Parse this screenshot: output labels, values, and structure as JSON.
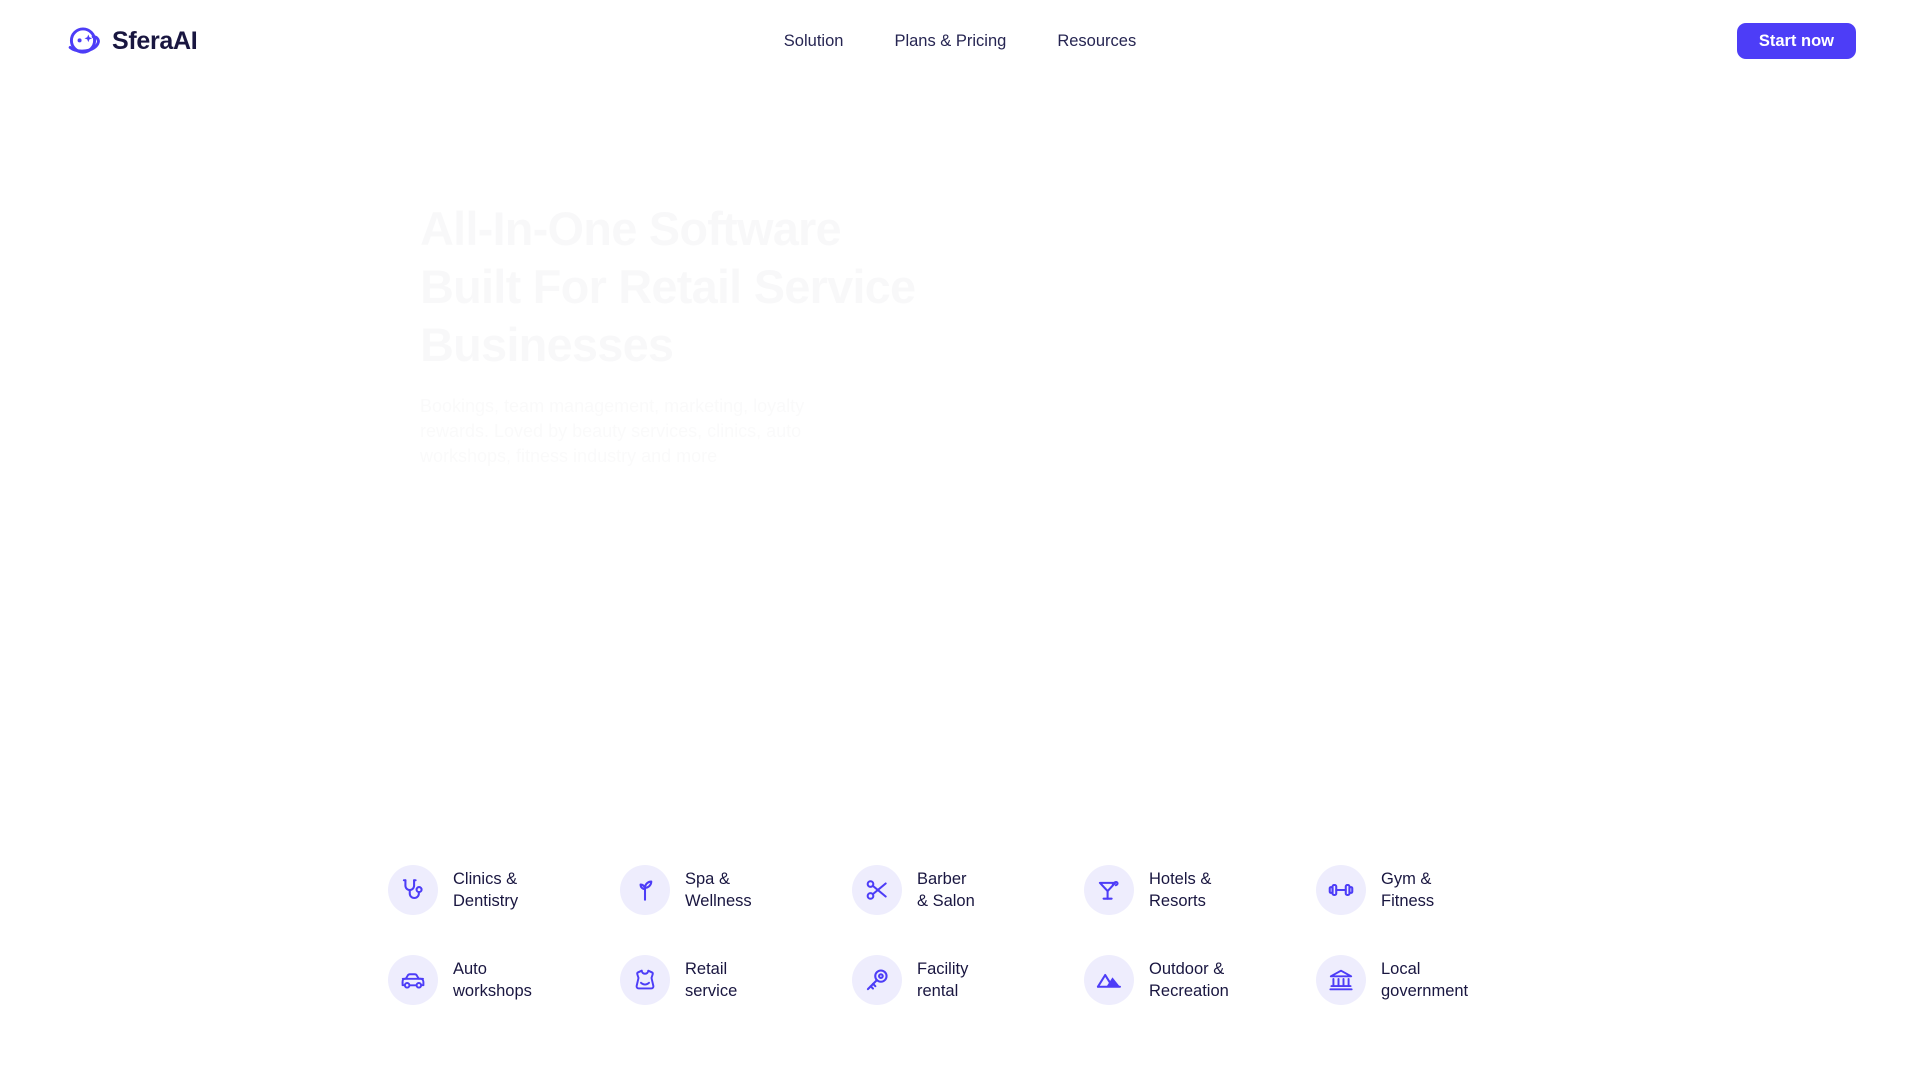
{
  "brand": {
    "name": "SferaAI",
    "logo_icon": "planet-sparkle-logo-icon",
    "accent_color": "#4D3DF7",
    "text_color": "#191640"
  },
  "nav": {
    "items": [
      {
        "label": "Solution"
      },
      {
        "label": "Plans & Pricing"
      },
      {
        "label": "Resources"
      }
    ]
  },
  "header": {
    "cta_label": "Start now",
    "cta_bg": "#4D3DF7",
    "cta_text_color": "#FFFFFF"
  },
  "hero": {
    "title": "All-In-One Software Built For Retail Service Businesses",
    "subtitle": "Bookings, team management, marketing, loyalty rewards. Loved by beauty services, clinics, auto workshops, fitness industry and more"
  },
  "categories": {
    "bubble_bg": "#EEEDFD",
    "icon_color": "#4D3DF7",
    "label_color": "#191640",
    "items": [
      {
        "label": "Clinics &\nDentistry",
        "icon": "stethoscope-icon"
      },
      {
        "label": "Spa &\nWellness",
        "icon": "sprout-icon"
      },
      {
        "label": "Barber\n& Salon",
        "icon": "scissors-icon"
      },
      {
        "label": "Hotels &\nResorts",
        "icon": "cocktail-glass-icon"
      },
      {
        "label": "Gym &\nFitness",
        "icon": "dumbbell-icon"
      },
      {
        "label": "Auto\nworkshops",
        "icon": "car-icon"
      },
      {
        "label": "Retail\nservice",
        "icon": "dress-icon"
      },
      {
        "label": "Facility\nrental",
        "icon": "key-icon"
      },
      {
        "label": "Outdoor &\nRecreation",
        "icon": "mountains-icon"
      },
      {
        "label": "Local\ngovernment",
        "icon": "bank-building-icon"
      }
    ]
  }
}
